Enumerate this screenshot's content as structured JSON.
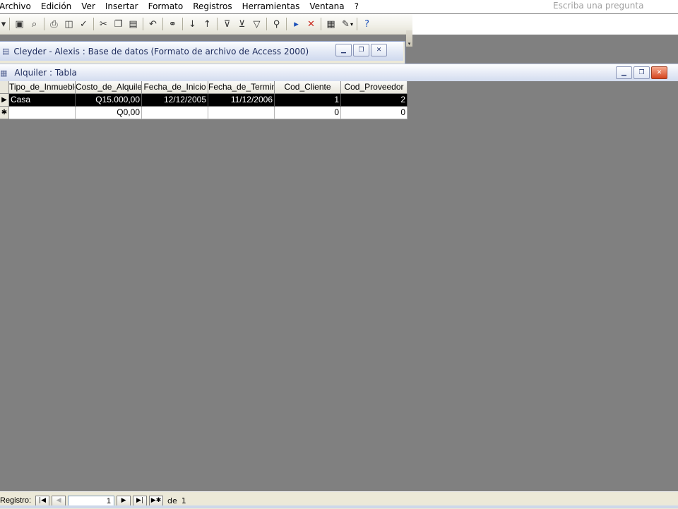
{
  "menu": {
    "items": [
      "Archivo",
      "Edición",
      "Ver",
      "Insertar",
      "Formato",
      "Registros",
      "Herramientas",
      "Ventana",
      "?"
    ],
    "ask_placeholder": "Escriba una pregunta"
  },
  "toolbar": {
    "icons": [
      "view-icon",
      "save-icon",
      "search-file-icon",
      "print-icon",
      "print-preview-icon",
      "spellcheck-icon",
      "cut-icon",
      "copy-icon",
      "paste-icon",
      "undo-icon",
      "hyperlink-icon",
      "sort-asc-icon",
      "sort-desc-icon",
      "filter-selection-icon",
      "filter-form-icon",
      "apply-filter-icon",
      "find-icon",
      "new-record-icon",
      "delete-record-icon",
      "database-window-icon",
      "new-object-icon",
      "help-icon"
    ]
  },
  "db_window": {
    "title": "Cleyder - Alexis : Base de datos (Formato de archivo de Access 2000)"
  },
  "table_window": {
    "title": "Alquiler : Tabla",
    "columns": [
      "Tipo_de_Inmueble",
      "Costo_de_Alquiler",
      "Fecha_de_Inicio",
      "Fecha_de_Termino",
      "Cod_Cliente",
      "Cod_Proveedor"
    ],
    "rows": [
      {
        "selector": "▶",
        "cells": [
          "Casa",
          "Q15.000,00",
          "12/12/2005",
          "11/12/2006",
          "1",
          "2"
        ]
      },
      {
        "selector": "✱",
        "cells": [
          "",
          "Q0,00",
          "",
          "",
          "0",
          "0"
        ]
      }
    ]
  },
  "navigation": {
    "label": "Registro:",
    "current": "1",
    "of_label": "de",
    "total": "1"
  }
}
